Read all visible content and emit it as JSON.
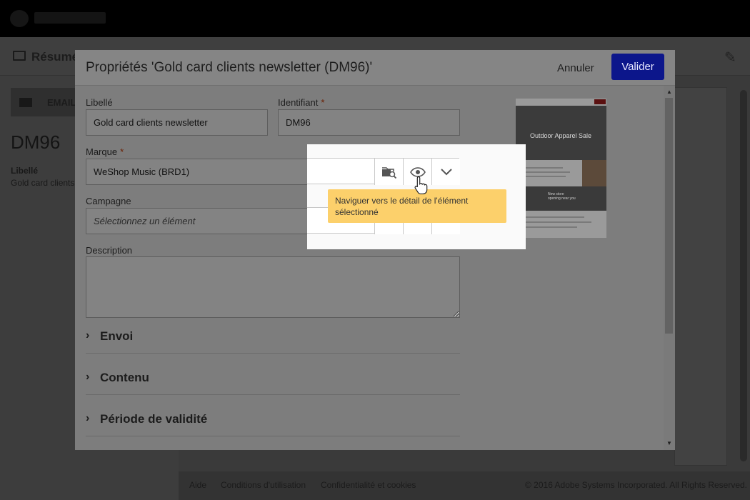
{
  "app": {
    "subheader_title": "Résumé",
    "left_panel": {
      "type_label": "EMAIL",
      "code": "DM96",
      "libelle_label": "Libellé",
      "libelle_value": "Gold card clients"
    },
    "footer": {
      "links": [
        "Aide",
        "Conditions d'utilisation",
        "Confidentialité et cookies"
      ],
      "copyright": "© 2016 Adobe Systems Incorporated. All Rights Reserved."
    }
  },
  "modal": {
    "title": "Propriétés 'Gold card clients newsletter (DM96)'",
    "cancel_label": "Annuler",
    "ok_label": "Valider",
    "fields": {
      "libelle": {
        "label": "Libellé",
        "value": "Gold card clients newsletter"
      },
      "identifiant": {
        "label": "Identifiant",
        "value": "DM96",
        "required_mark": "*"
      },
      "marque": {
        "label": "Marque",
        "value": "WeShop Music (BRD1)",
        "required_mark": "*"
      },
      "campagne": {
        "label": "Campagne",
        "placeholder": "Sélectionnez un élément"
      },
      "description": {
        "label": "Description",
        "value": ""
      }
    },
    "sections": [
      "Envoi",
      "Contenu",
      "Période de validité"
    ],
    "preview": {
      "hero_text": "Outdoor Apparel Sale",
      "promo_text": "New store opening near you"
    }
  },
  "tooltip": {
    "text": "Naviguer vers le détail de l'élément sélectionné"
  },
  "icons": {
    "browse": "folder-search-icon",
    "view": "eye-icon",
    "dropdown": "chevron-down-icon",
    "section": "chevron-right-icon",
    "edit": "pencil-icon"
  },
  "colors": {
    "primary_button": "#0c168b",
    "tooltip_bg": "#fcd06b",
    "required": "#c65100"
  }
}
